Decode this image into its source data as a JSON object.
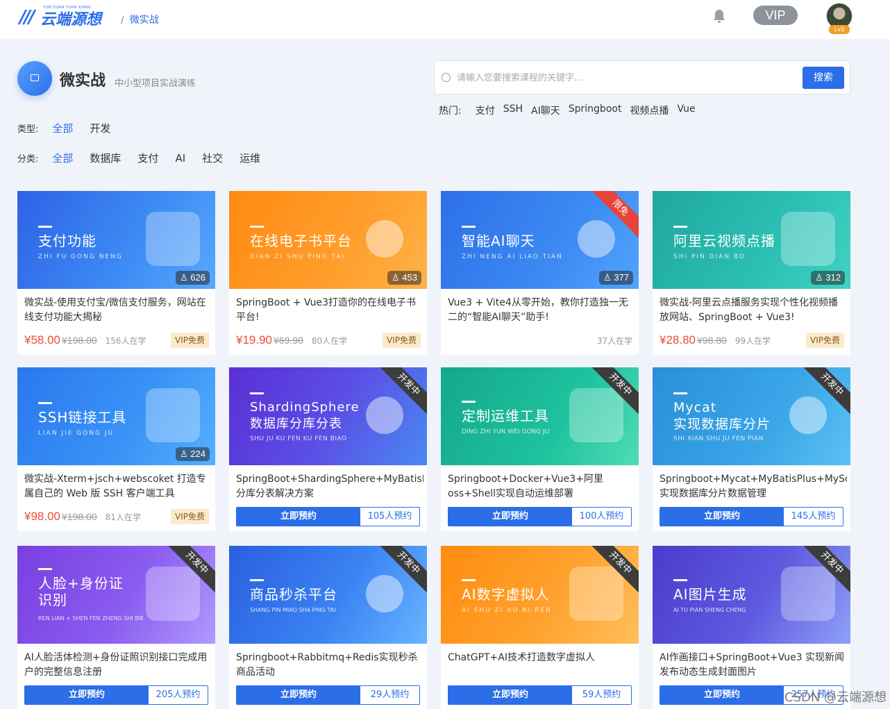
{
  "header": {
    "logo_text": "云端源想",
    "logo_sub": "YUN DUAN YUAN XIANG",
    "breadcrumb_sep": "/",
    "breadcrumb": "微实战",
    "vip": "VIP",
    "level": "Lv3"
  },
  "page": {
    "title": "微实战",
    "subtitle": "中小型项目实战演练"
  },
  "search": {
    "placeholder": "请输入您要搜索课程的关键字...",
    "button": "搜索",
    "hot_label": "热门:",
    "hot_items": [
      "支付",
      "SSH",
      "AI聊天",
      "Springboot",
      "视频点播",
      "Vue"
    ]
  },
  "filters": {
    "type": {
      "label": "类型:",
      "items": [
        "全部",
        "开发"
      ],
      "active": 0
    },
    "category": {
      "label": "分类:",
      "items": [
        "全部",
        "数据库",
        "支付",
        "AI",
        "社交",
        "运维"
      ],
      "active": 0
    }
  },
  "colors": {
    "accent": "#2b6ee8",
    "price": "#ea4b3c",
    "vip_badge_bg": "#fbeacc"
  },
  "cards": [
    {
      "title": "支付功能",
      "pinyin": "ZHI  FU  GONG  NENG",
      "learn_count": "626",
      "desc": "微实战-使用支付宝/微信支付服务，网站在线支付功能大揭秘",
      "price": "¥58.00",
      "original_price": "¥198.00",
      "learners": "156人在学",
      "vip": "VIP免费"
    },
    {
      "title": "在线电子书平台",
      "pinyin": "DIAN  ZI  SHU  PING  TAI",
      "learn_count": "453",
      "desc": "SpringBoot + Vue3打造你的在线电子书平台!",
      "price": "¥19.90",
      "original_price": "¥69.90",
      "learners": "80人在学",
      "vip": "VIP免费"
    },
    {
      "title": "智能AI聊天",
      "pinyin": "ZHI  NENG  AI  LIAO  TIAN",
      "learn_count": "377",
      "ribbon": "限免",
      "desc": "Vue3 + Vite4从零开始，教你打造独一无二的“智能AI聊天”助手!",
      "learners": "37人在学"
    },
    {
      "title": "阿里云视频点播",
      "pinyin": "SHI  PIN  DIAN  BO",
      "learn_count": "312",
      "desc": "微实战-阿里云点播服务实现个性化视频播放网站、SpringBoot + Vue3!",
      "price": "¥28.80",
      "original_price": "¥98.80",
      "learners": "99人在学",
      "vip": "VIP免费"
    },
    {
      "title": "SSH链接工具",
      "pinyin": "LIAN  JIE  GONG  JU",
      "learn_count": "224",
      "desc": "微实战-Xterm+jsch+webscoket 打造专属自己的 Web 版 SSH 客户端工具",
      "price": "¥98.00",
      "original_price": "¥198.00",
      "learners": "81人在学",
      "vip": "VIP免费"
    },
    {
      "title_line1": "ShardingSphere",
      "title_line2": "数据库分库分表",
      "pinyin": "SHU JU KU FEN KU FEN BIAO",
      "ribbon": "开发中",
      "desc_line1": "SpringBoot+ShardingSphere+MyBatisPlus",
      "desc_line2": "分库分表解决方案",
      "reserve": "立即预约",
      "reserve_count": "105人预约"
    },
    {
      "title": "定制运维工具",
      "pinyin": "DING ZHI YUN WEI GONG JU",
      "ribbon": "开发中",
      "desc": "Springboot+Docker+Vue3+阿里oss+Shell实现自动运维部署",
      "reserve": "立即预约",
      "reserve_count": "100人预约"
    },
    {
      "title_line1": "Mycat",
      "title_line2": "实现数据库分片",
      "pinyin": "SHI XIAN SHU JU FEN PIAN",
      "ribbon": "开发中",
      "desc_line1": "Springboot+Mycat+MyBatisPlus+MySql",
      "desc_line2": "实现数据库分片数据管理",
      "reserve": "立即预约",
      "reserve_count": "145人预约"
    },
    {
      "title_line1": "人脸+身份证",
      "title_line2": "识别",
      "pinyin": "REN LIAN + SHEN FEN ZHENG SHI BIE",
      "ribbon": "开发中",
      "desc": "AI人脸活体检测+身份证照识别接口完成用户的完整信息注册",
      "reserve": "立即预约",
      "reserve_count": "205人预约"
    },
    {
      "title": "商品秒杀平台",
      "pinyin": "SHANG PIN MIAO SHA PING TAI",
      "ribbon": "开发中",
      "desc": "Springboot+Rabbitmq+Redis实现秒杀商品活动",
      "reserve": "立即预约",
      "reserve_count": "29人预约"
    },
    {
      "title": "AI数字虚拟人",
      "pinyin": "AI  SHU  ZI  XU  NI  REN",
      "ribbon": "开发中",
      "desc": "ChatGPT+AI技术打造数字虚拟人",
      "reserve": "立即预约",
      "reserve_count": "59人预约"
    },
    {
      "title": "AI图片生成",
      "pinyin": "AI TU PIAN SHENG CHENG",
      "ribbon": "开发中",
      "desc": "AI作画接口+SpringBoot+Vue3 实现新闻发布动态生成封面图片",
      "reserve": "立即预约",
      "reserve_count": "257人预约"
    }
  ],
  "watermark": "CSDN @云端源想"
}
